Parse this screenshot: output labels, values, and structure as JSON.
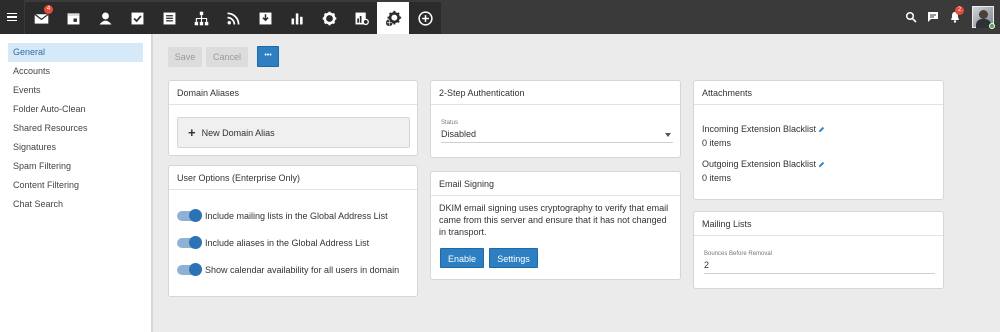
{
  "topnav": {
    "mail_badge": "4",
    "notifications_badge": "2"
  },
  "sidebar": {
    "items": [
      {
        "label": "General"
      },
      {
        "label": "Accounts"
      },
      {
        "label": "Events"
      },
      {
        "label": "Folder Auto-Clean"
      },
      {
        "label": "Shared Resources"
      },
      {
        "label": "Signatures"
      },
      {
        "label": "Spam Filtering"
      },
      {
        "label": "Content Filtering"
      },
      {
        "label": "Chat Search"
      }
    ]
  },
  "toolbar": {
    "save_label": "Save",
    "cancel_label": "Cancel",
    "more_label": "•••"
  },
  "domain_aliases": {
    "title": "Domain Aliases",
    "add_label": "New Domain Alias"
  },
  "user_options": {
    "title": "User Options (Enterprise Only)",
    "toggles": [
      {
        "label": "Include mailing lists in the Global Address List",
        "on": true
      },
      {
        "label": "Include aliases in the Global Address List",
        "on": true
      },
      {
        "label": "Show calendar availability for all users in domain",
        "on": true
      }
    ]
  },
  "two_step": {
    "title": "2-Step Authentication",
    "status_label": "Status",
    "status_value": "Disabled"
  },
  "email_signing": {
    "title": "Email Signing",
    "description": "DKIM email signing uses cryptography to verify that email came from this server and ensure that it has not changed in transport.",
    "enable_label": "Enable",
    "settings_label": "Settings"
  },
  "attachments": {
    "title": "Attachments",
    "incoming_label": "Incoming Extension Blacklist",
    "incoming_value": "0 items",
    "outgoing_label": "Outgoing Extension Blacklist",
    "outgoing_value": "0 items"
  },
  "mailing_lists": {
    "title": "Mailing Lists",
    "bounces_label": "Bounces Before Removal",
    "bounces_value": "2"
  },
  "colors": {
    "accent": "#2d7fc1",
    "topbar": "#3a3a3a",
    "badge": "#e84b3a",
    "online": "#43b047"
  }
}
